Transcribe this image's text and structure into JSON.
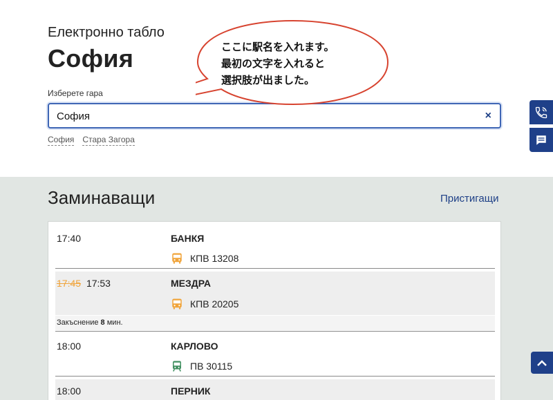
{
  "header": {
    "subtitle": "Електронно табло",
    "station_title": "София"
  },
  "search": {
    "label": "Изберете гара",
    "value": "София",
    "clear_glyph": "×"
  },
  "suggestions": [
    "София",
    "Стара Загора"
  ],
  "annotation": {
    "lines": [
      "ここに駅名を入れます。",
      "最初の文字を入れると",
      "選択肢が出ました。"
    ]
  },
  "board": {
    "title": "Заминаващи",
    "arrivals_link": "Пристигащи",
    "rows": [
      {
        "time": "17:40",
        "old_time": "",
        "destination": "БАНКЯ",
        "train": "КПВ 13208",
        "vehicle_icon": "bus-icon",
        "icon_color": "#f0a43a",
        "delay_prefix": "",
        "delay_minutes": "",
        "delay_suffix": ""
      },
      {
        "time": "17:53",
        "old_time": "17:45",
        "destination": "МЕЗДРА",
        "train": "КПВ 20205",
        "vehicle_icon": "bus-icon",
        "icon_color": "#f0a43a",
        "delay_prefix": "Закъснение",
        "delay_minutes": "8",
        "delay_suffix": "мин."
      },
      {
        "time": "18:00",
        "old_time": "",
        "destination": "КАРЛОВО",
        "train": "ПВ 30115",
        "vehicle_icon": "train-icon",
        "icon_color": "#3f8f5f",
        "delay_prefix": "",
        "delay_minutes": "",
        "delay_suffix": ""
      },
      {
        "time": "18:00",
        "old_time": "",
        "destination": "ПЕРНИК",
        "train": "",
        "vehicle_icon": "",
        "icon_color": "",
        "delay_prefix": "",
        "delay_minutes": "",
        "delay_suffix": ""
      }
    ]
  },
  "side_buttons": {
    "phone_icon": "phone-icon",
    "chat_icon": "chat-icon",
    "scroll_icon": "chevron-up-icon"
  },
  "colors": {
    "accent": "#1f4089",
    "delay": "#f0a43a",
    "callout_border": "#d7432f"
  }
}
